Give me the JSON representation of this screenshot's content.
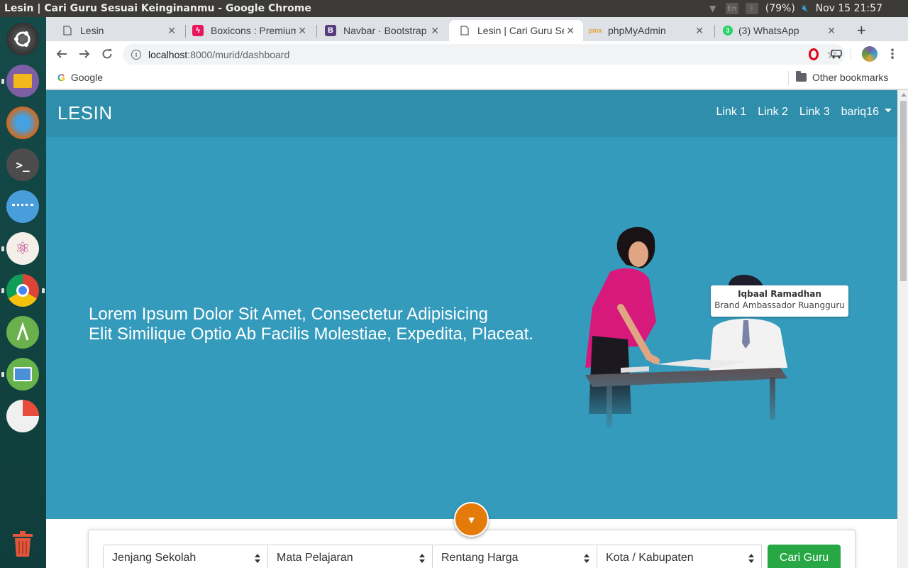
{
  "os": {
    "window_title": "Lesin | Cari Guru Sesuai Keinginanmu - Google Chrome",
    "battery": "(79%)",
    "datetime": "Nov 15 21:57"
  },
  "browser": {
    "tabs": [
      {
        "label": "Lesin",
        "icon": "page-icon"
      },
      {
        "label": "Boxicons : Premium",
        "icon": "boxicons-icon"
      },
      {
        "label": "Navbar · Bootstrap",
        "icon": "bootstrap-icon"
      },
      {
        "label": "Lesin | Cari Guru Sesuai",
        "icon": "page-icon",
        "active": true
      },
      {
        "label": "phpMyAdmin",
        "icon": "phpmyadmin-icon"
      },
      {
        "label": "(3) WhatsApp",
        "icon": "whatsapp-icon",
        "badge": "3"
      }
    ],
    "url_host": "localhost",
    "url_path": ":8000/murid/dashboard",
    "bookmarks": {
      "google": "Google",
      "other": "Other bookmarks"
    }
  },
  "page": {
    "brand": "LESIN",
    "nav": {
      "link1": "Link 1",
      "link2": "Link 2",
      "link3": "Link 3",
      "user": "bariq16"
    },
    "hero": {
      "line1": "Lorem Ipsum Dolor Sit Amet, Consectetur Adipisicing",
      "line2": "Elit Similique Optio Ab Facilis Molestiae, Expedita, Placeat.",
      "badge_name": "Iqbaal Ramadhan",
      "badge_role": "Brand Ambassador Ruangguru"
    },
    "search": {
      "jenjang": "Jenjang Sekolah",
      "mapel": "Mata Pelajaran",
      "harga": "Rentang Harga",
      "kota": "Kota / Kabupaten",
      "button": "Cari Guru"
    }
  },
  "colors": {
    "navbar": "#2f8eab",
    "hero": "#359bbc",
    "accent_button": "#e47b09",
    "search_button": "#28a745"
  }
}
